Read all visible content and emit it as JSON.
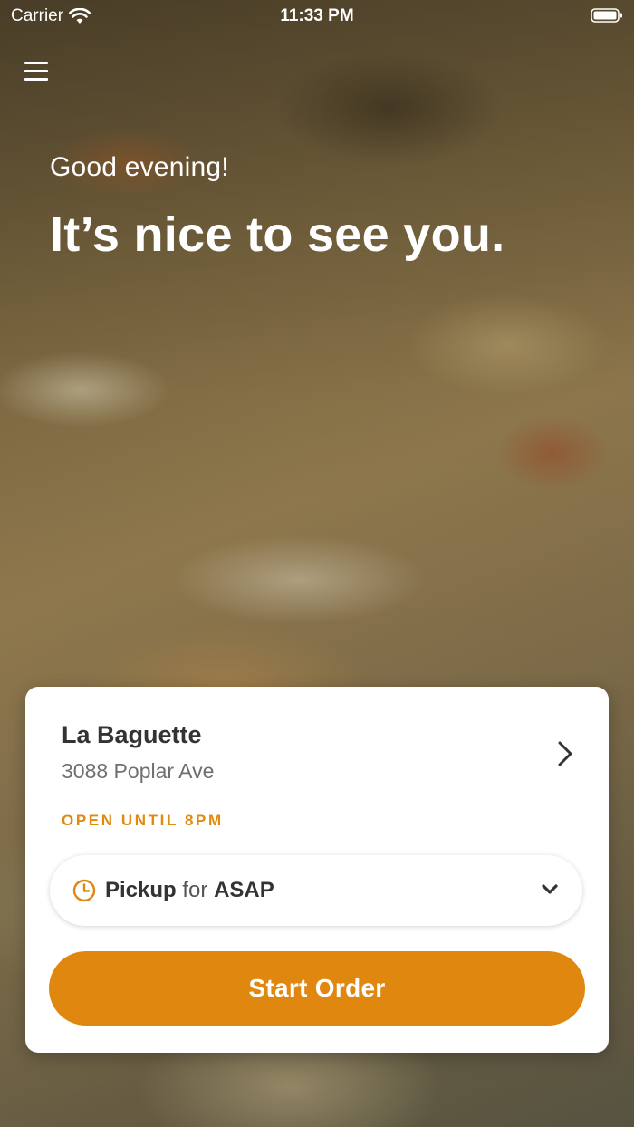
{
  "status_bar": {
    "carrier": "Carrier",
    "time": "11:33 PM"
  },
  "header": {
    "menu_icon": "hamburger-menu-icon",
    "greeting": "Good evening!",
    "headline": "It’s nice to see you."
  },
  "store": {
    "name": "La Baguette",
    "address": "3088 Poplar Ave",
    "open_status": "OPEN UNTIL 8PM"
  },
  "pickup": {
    "icon": "clock-icon",
    "mode": "Pickup",
    "connector": "for",
    "time": "ASAP"
  },
  "actions": {
    "start_order_label": "Start Order"
  },
  "colors": {
    "accent": "#e0870f",
    "card_background": "#ffffff",
    "title_text": "#333333"
  }
}
